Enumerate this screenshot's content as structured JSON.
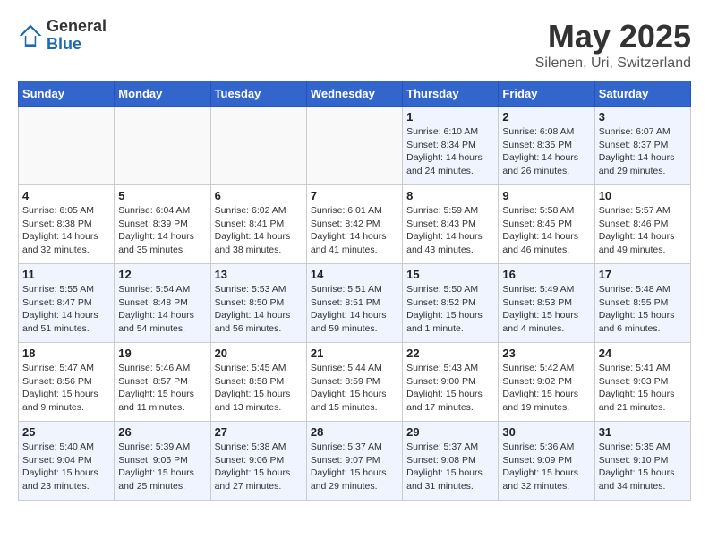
{
  "header": {
    "logo_general": "General",
    "logo_blue": "Blue",
    "main_title": "May 2025",
    "subtitle": "Silenen, Uri, Switzerland"
  },
  "days_of_week": [
    "Sunday",
    "Monday",
    "Tuesday",
    "Wednesday",
    "Thursday",
    "Friday",
    "Saturday"
  ],
  "weeks": [
    [
      {
        "day": "",
        "info": ""
      },
      {
        "day": "",
        "info": ""
      },
      {
        "day": "",
        "info": ""
      },
      {
        "day": "",
        "info": ""
      },
      {
        "day": "1",
        "info": "Sunrise: 6:10 AM\nSunset: 8:34 PM\nDaylight: 14 hours\nand 24 minutes."
      },
      {
        "day": "2",
        "info": "Sunrise: 6:08 AM\nSunset: 8:35 PM\nDaylight: 14 hours\nand 26 minutes."
      },
      {
        "day": "3",
        "info": "Sunrise: 6:07 AM\nSunset: 8:37 PM\nDaylight: 14 hours\nand 29 minutes."
      }
    ],
    [
      {
        "day": "4",
        "info": "Sunrise: 6:05 AM\nSunset: 8:38 PM\nDaylight: 14 hours\nand 32 minutes."
      },
      {
        "day": "5",
        "info": "Sunrise: 6:04 AM\nSunset: 8:39 PM\nDaylight: 14 hours\nand 35 minutes."
      },
      {
        "day": "6",
        "info": "Sunrise: 6:02 AM\nSunset: 8:41 PM\nDaylight: 14 hours\nand 38 minutes."
      },
      {
        "day": "7",
        "info": "Sunrise: 6:01 AM\nSunset: 8:42 PM\nDaylight: 14 hours\nand 41 minutes."
      },
      {
        "day": "8",
        "info": "Sunrise: 5:59 AM\nSunset: 8:43 PM\nDaylight: 14 hours\nand 43 minutes."
      },
      {
        "day": "9",
        "info": "Sunrise: 5:58 AM\nSunset: 8:45 PM\nDaylight: 14 hours\nand 46 minutes."
      },
      {
        "day": "10",
        "info": "Sunrise: 5:57 AM\nSunset: 8:46 PM\nDaylight: 14 hours\nand 49 minutes."
      }
    ],
    [
      {
        "day": "11",
        "info": "Sunrise: 5:55 AM\nSunset: 8:47 PM\nDaylight: 14 hours\nand 51 minutes."
      },
      {
        "day": "12",
        "info": "Sunrise: 5:54 AM\nSunset: 8:48 PM\nDaylight: 14 hours\nand 54 minutes."
      },
      {
        "day": "13",
        "info": "Sunrise: 5:53 AM\nSunset: 8:50 PM\nDaylight: 14 hours\nand 56 minutes."
      },
      {
        "day": "14",
        "info": "Sunrise: 5:51 AM\nSunset: 8:51 PM\nDaylight: 14 hours\nand 59 minutes."
      },
      {
        "day": "15",
        "info": "Sunrise: 5:50 AM\nSunset: 8:52 PM\nDaylight: 15 hours\nand 1 minute."
      },
      {
        "day": "16",
        "info": "Sunrise: 5:49 AM\nSunset: 8:53 PM\nDaylight: 15 hours\nand 4 minutes."
      },
      {
        "day": "17",
        "info": "Sunrise: 5:48 AM\nSunset: 8:55 PM\nDaylight: 15 hours\nand 6 minutes."
      }
    ],
    [
      {
        "day": "18",
        "info": "Sunrise: 5:47 AM\nSunset: 8:56 PM\nDaylight: 15 hours\nand 9 minutes."
      },
      {
        "day": "19",
        "info": "Sunrise: 5:46 AM\nSunset: 8:57 PM\nDaylight: 15 hours\nand 11 minutes."
      },
      {
        "day": "20",
        "info": "Sunrise: 5:45 AM\nSunset: 8:58 PM\nDaylight: 15 hours\nand 13 minutes."
      },
      {
        "day": "21",
        "info": "Sunrise: 5:44 AM\nSunset: 8:59 PM\nDaylight: 15 hours\nand 15 minutes."
      },
      {
        "day": "22",
        "info": "Sunrise: 5:43 AM\nSunset: 9:00 PM\nDaylight: 15 hours\nand 17 minutes."
      },
      {
        "day": "23",
        "info": "Sunrise: 5:42 AM\nSunset: 9:02 PM\nDaylight: 15 hours\nand 19 minutes."
      },
      {
        "day": "24",
        "info": "Sunrise: 5:41 AM\nSunset: 9:03 PM\nDaylight: 15 hours\nand 21 minutes."
      }
    ],
    [
      {
        "day": "25",
        "info": "Sunrise: 5:40 AM\nSunset: 9:04 PM\nDaylight: 15 hours\nand 23 minutes."
      },
      {
        "day": "26",
        "info": "Sunrise: 5:39 AM\nSunset: 9:05 PM\nDaylight: 15 hours\nand 25 minutes."
      },
      {
        "day": "27",
        "info": "Sunrise: 5:38 AM\nSunset: 9:06 PM\nDaylight: 15 hours\nand 27 minutes."
      },
      {
        "day": "28",
        "info": "Sunrise: 5:37 AM\nSunset: 9:07 PM\nDaylight: 15 hours\nand 29 minutes."
      },
      {
        "day": "29",
        "info": "Sunrise: 5:37 AM\nSunset: 9:08 PM\nDaylight: 15 hours\nand 31 minutes."
      },
      {
        "day": "30",
        "info": "Sunrise: 5:36 AM\nSunset: 9:09 PM\nDaylight: 15 hours\nand 32 minutes."
      },
      {
        "day": "31",
        "info": "Sunrise: 5:35 AM\nSunset: 9:10 PM\nDaylight: 15 hours\nand 34 minutes."
      }
    ]
  ]
}
